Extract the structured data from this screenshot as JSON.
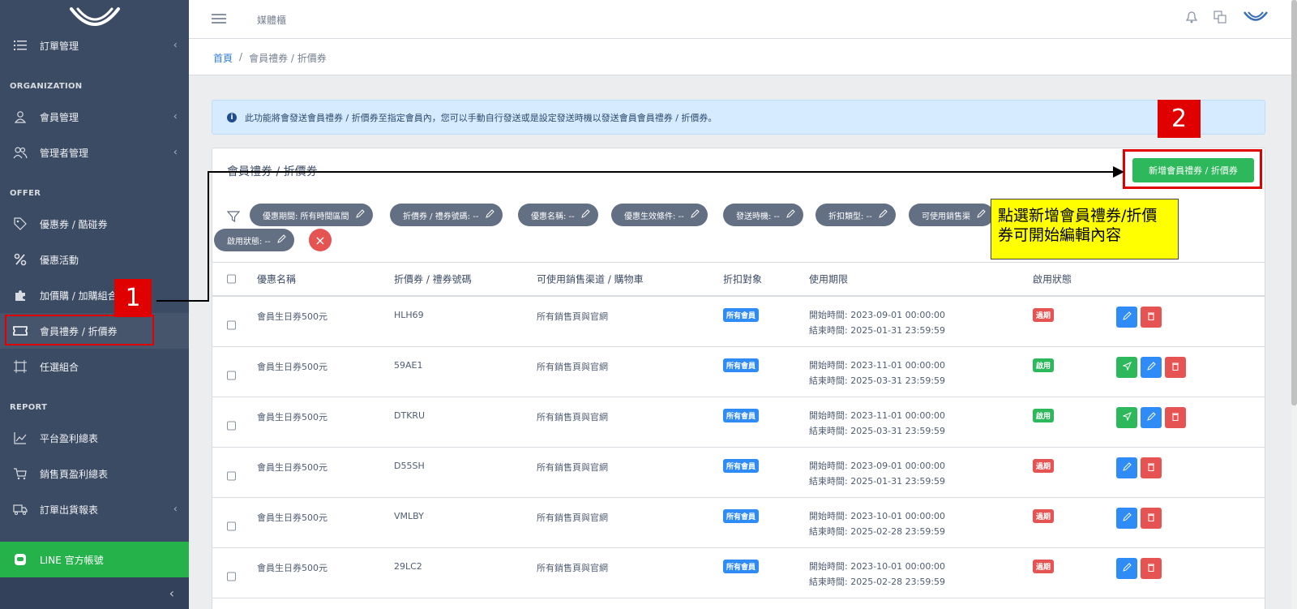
{
  "header": {
    "title": "媒體櫃"
  },
  "breadcrumb": {
    "home": "首頁",
    "sep": "/",
    "current": "會員禮券 / 折價券"
  },
  "sidebar": {
    "items": [
      {
        "label": "訂單管理",
        "icon": "list-icon",
        "chevron": true
      },
      {
        "section": "ORGANIZATION"
      },
      {
        "label": "會員管理",
        "icon": "user-icon",
        "chevron": true
      },
      {
        "label": "管理者管理",
        "icon": "users-icon",
        "chevron": true
      },
      {
        "section": "OFFER"
      },
      {
        "label": "優惠券 / 酷碰券",
        "icon": "tag-icon"
      },
      {
        "label": "優惠活動",
        "icon": "percent-icon"
      },
      {
        "label": "加價購 / 加購組合",
        "icon": "puzzle-icon"
      },
      {
        "label": "會員禮券 / 折價券",
        "icon": "ticket-icon",
        "active": true
      },
      {
        "label": "任選組合",
        "icon": "frame-icon"
      },
      {
        "section": "REPORT"
      },
      {
        "label": "平台盈利總表",
        "icon": "chart-line-icon"
      },
      {
        "label": "銷售頁盈利總表",
        "icon": "cart-icon"
      },
      {
        "label": "訂單出貨報表",
        "icon": "truck-icon",
        "chevron": true
      }
    ],
    "line_item": "LINE 官方帳號"
  },
  "alert": {
    "text": "此功能將會發送會員禮券 / 折價券至指定會員內，您可以手動自行發送或是設定發送時機以發送會員會員禮券 / 折價券。"
  },
  "card": {
    "title": "會員禮券 / 折價券",
    "add_button": "新增會員禮券 / 折價券"
  },
  "filters": [
    "優惠期間: 所有時間區間",
    "折價券 / 禮券號碼: --",
    "優惠名稱: --",
    "優惠生效條件: --",
    "發送時機: --",
    "折扣類型: --",
    "可使用銷售渠",
    "啟用狀態: --"
  ],
  "table": {
    "columns": [
      "優惠名稱",
      "折價券 / 禮券號碼",
      "可使用銷售渠道 / 購物車",
      "折扣對象",
      "使用期限",
      "啟用狀態"
    ],
    "rows": [
      {
        "name": "會員生日券500元",
        "code": "HLH69",
        "channel": "所有銷售頁與官網",
        "target": "所有會員",
        "start": "開始時間: 2023-09-01 00:00:00",
        "end": "結束時間: 2025-01-31 23:59:59",
        "status": "過期",
        "send": false
      },
      {
        "name": "會員生日券500元",
        "code": "59AE1",
        "channel": "所有銷售頁與官網",
        "target": "所有會員",
        "start": "開始時間: 2023-11-01 00:00:00",
        "end": "結束時間: 2025-03-31 23:59:59",
        "status": "啟用",
        "send": true
      },
      {
        "name": "會員生日券500元",
        "code": "DTKRU",
        "channel": "所有銷售頁與官網",
        "target": "所有會員",
        "start": "開始時間: 2023-11-01 00:00:00",
        "end": "結束時間: 2025-03-31 23:59:59",
        "status": "啟用",
        "send": true
      },
      {
        "name": "會員生日券500元",
        "code": "D55SH",
        "channel": "所有銷售頁與官網",
        "target": "所有會員",
        "start": "開始時間: 2023-09-01 00:00:00",
        "end": "結束時間: 2025-01-31 23:59:59",
        "status": "過期",
        "send": false
      },
      {
        "name": "會員生日券500元",
        "code": "VMLBY",
        "channel": "所有銷售頁與官網",
        "target": "所有會員",
        "start": "開始時間: 2023-10-01 00:00:00",
        "end": "結束時間: 2025-02-28 23:59:59",
        "status": "過期",
        "send": false
      },
      {
        "name": "會員生日券500元",
        "code": "29LC2",
        "channel": "所有銷售頁與官網",
        "target": "所有會員",
        "start": "開始時間: 2023-10-01 00:00:00",
        "end": "結束時間: 2025-02-28 23:59:59",
        "status": "過期",
        "send": false
      }
    ]
  },
  "annotations": {
    "step1": "1",
    "step2": "2",
    "note": "點選新增會員禮券/折價券可開始編輯內容"
  },
  "colors": {
    "sidebar": "#3c4b64",
    "primary": "#2f8bf5",
    "success": "#2eb85c",
    "danger": "#e55353",
    "highlight": "#e10000",
    "note": "#ffff00"
  }
}
